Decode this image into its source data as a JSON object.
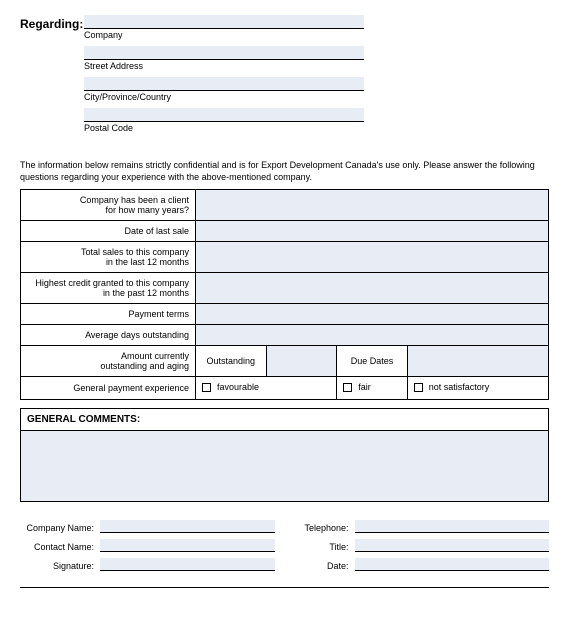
{
  "regarding": {
    "title": "Regarding:",
    "fields": [
      {
        "caption": "Company"
      },
      {
        "caption": "Street Address"
      },
      {
        "caption": "City/Province/Country"
      },
      {
        "caption": "Postal Code"
      }
    ]
  },
  "intro": "The information below remains strictly confidential and is for Export Development Canada's use only. Please answer the following questions regarding your experience with the above-mentioned company.",
  "rows": {
    "client_years": "Company has been a client\nfor how many years?",
    "last_sale": "Date of last sale",
    "total_sales": "Total sales to this company\nin the last 12 months",
    "highest_credit": "Highest credit granted to this company\nin the past 12 months",
    "payment_terms": "Payment terms",
    "avg_days": "Average days outstanding",
    "amount_current": "Amount currently\noutstanding and aging",
    "outstanding": "Outstanding",
    "due_dates": "Due Dates",
    "gpe": "General payment experience",
    "favourable": "favourable",
    "fair": "fair",
    "not_satisfactory": "not satisfactory"
  },
  "comments": {
    "title": "GENERAL COMMENTS:"
  },
  "contact": {
    "company_name": "Company Name:",
    "contact_name": "Contact Name:",
    "signature": "Signature:",
    "telephone": "Telephone:",
    "title": "Title:",
    "date": "Date:"
  }
}
